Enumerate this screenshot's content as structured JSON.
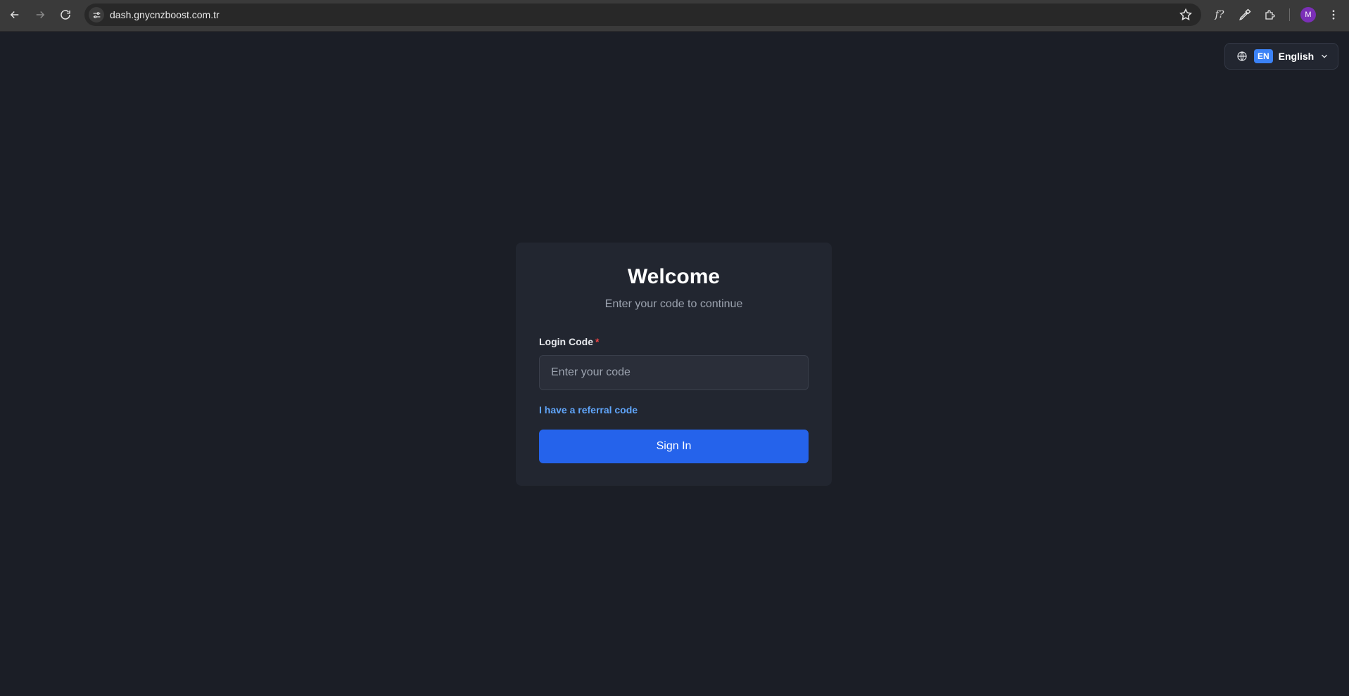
{
  "browser": {
    "url": "dash.gnycnzboost.com.tr",
    "profile_initial": "M"
  },
  "language": {
    "code": "EN",
    "name": "English"
  },
  "login": {
    "title": "Welcome",
    "subtitle": "Enter your code to continue",
    "code_label": "Login Code",
    "required_mark": "*",
    "code_placeholder": "Enter your code",
    "code_value": "",
    "referral_link": "I have a referral code",
    "signin_label": "Sign In"
  },
  "colors": {
    "background": "#1b1e26",
    "card": "#222630",
    "primary": "#2563eb",
    "link": "#60a5fa",
    "required": "#ef4444",
    "badge": "#3b82f6"
  },
  "icons": [
    "back-arrow-icon",
    "forward-arrow-icon",
    "reload-icon",
    "site-info-icon",
    "star-icon",
    "font-icon",
    "eyedropper-icon",
    "extensions-icon",
    "kebab-menu-icon",
    "globe-icon",
    "chevron-down-icon"
  ]
}
